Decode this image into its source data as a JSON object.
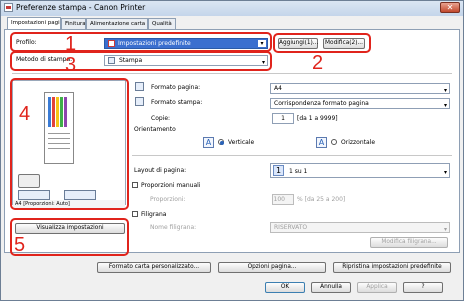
{
  "window": {
    "title": "Preferenze stampa - Canon Printer",
    "close_glyph": "✕"
  },
  "tabs": [
    {
      "label": "Impostazioni pagina"
    },
    {
      "label": "Finitura"
    },
    {
      "label": "Alimentazione carta"
    },
    {
      "label": "Qualità"
    }
  ],
  "profile": {
    "label": "Profilo:",
    "value": "Impostazioni predefinite",
    "add_label": "Aggiungi(1)...",
    "edit_label": "Modifica(2)..."
  },
  "output": {
    "label": "Metodo di stampa:",
    "value": "Stampa"
  },
  "preview": {
    "caption": "A4 [Proporzioni: Auto]",
    "view_settings_label": "Visualizza impostazioni"
  },
  "page": {
    "page_size_label": "Formato pagina:",
    "page_size_value": "A4",
    "output_size_label": "Formato stampa:",
    "output_size_value": "Corrispondenza formato pagina",
    "copies_label": "Copie:",
    "copies_value": "1",
    "copies_range": "[da 1 a 9999]",
    "orientation_label": "Orientamento",
    "portrait_label": "Verticale",
    "landscape_label": "Orizzontale",
    "layout_label": "Layout di pagina:",
    "layout_value": "1 su 1",
    "layout_icon_digit": "1",
    "manual_scaling_label": "Proporzioni manuali",
    "scaling_label": "Proporzioni:",
    "scaling_value": "100",
    "scaling_range": "% [da 25 a 200]",
    "watermark_label": "Filigrana",
    "watermark_name_label": "Nome filigrana:",
    "watermark_value": "RISERVATO",
    "edit_watermark_label": "Modifica filigrana..."
  },
  "bottom_buttons": {
    "custom_size": "Formato carta personalizzato...",
    "page_options": "Opzioni pagina...",
    "restore": "Ripristina impostazioni predefinite"
  },
  "dialog_buttons": {
    "ok": "OK",
    "cancel": "Annulla",
    "apply": "Applica",
    "help": "?"
  },
  "callouts": [
    "1",
    "2",
    "3",
    "4",
    "5"
  ],
  "colors": {
    "callout": "#e0241c",
    "accent": "#2a63b8"
  }
}
